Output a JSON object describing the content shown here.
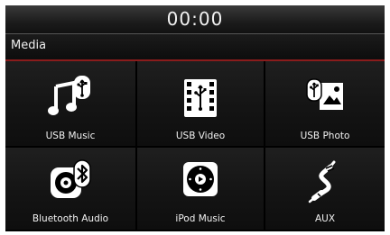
{
  "header": {
    "clock": "00:00"
  },
  "title_bar": {
    "title": "Media"
  },
  "tiles": [
    {
      "label": "USB Music",
      "icon": "usb-music-icon"
    },
    {
      "label": "USB Video",
      "icon": "usb-video-icon"
    },
    {
      "label": "USB Photo",
      "icon": "usb-photo-icon"
    },
    {
      "label": "Bluetooth Audio",
      "icon": "bluetooth-audio-icon"
    },
    {
      "label": "iPod Music",
      "icon": "ipod-music-icon"
    },
    {
      "label": "AUX",
      "icon": "aux-cable-icon"
    }
  ],
  "colors": {
    "background": "#000000",
    "accent": "#8a1c1c",
    "text": "#f2f2f2"
  }
}
